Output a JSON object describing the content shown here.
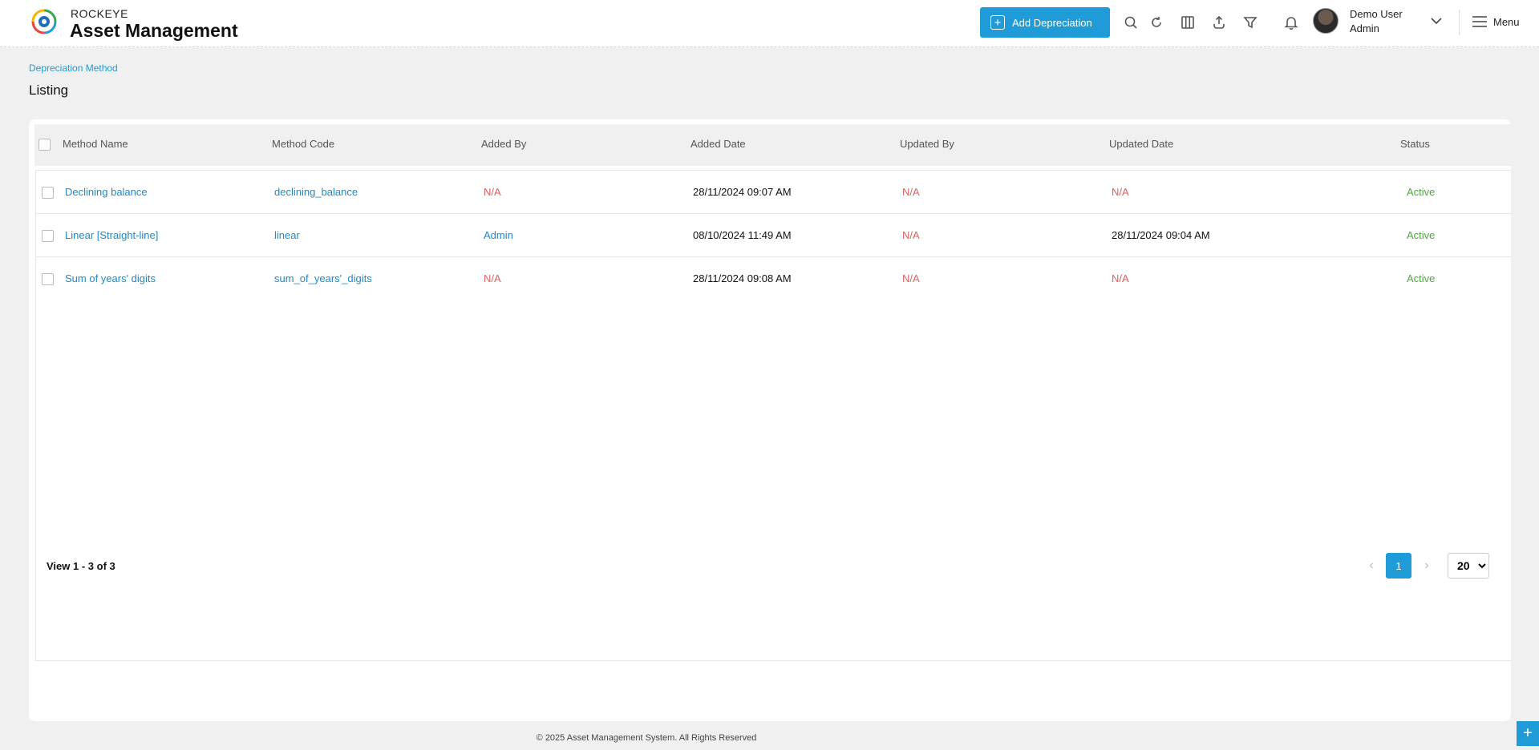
{
  "brand": {
    "top": "ROCKEYE",
    "name": "Asset Management"
  },
  "header": {
    "add_button": "Add Depreciation",
    "user_name": "Demo User",
    "user_role": "Admin",
    "menu_label": "Menu"
  },
  "breadcrumb": "Depreciation Method",
  "page_title": "Listing",
  "table": {
    "columns": [
      "Method Name",
      "Method Code",
      "Added By",
      "Added Date",
      "Updated By",
      "Updated Date",
      "Status"
    ],
    "rows": [
      {
        "name": "Declining balance",
        "code": "declining_balance",
        "added_by": "N/A",
        "added_date": "28/11/2024 09:07 AM",
        "updated_by": "N/A",
        "updated_date": "N/A",
        "status": "Active"
      },
      {
        "name": "Linear [Straight-line]",
        "code": "linear",
        "added_by": "Admin",
        "added_date": "08/10/2024 11:49 AM",
        "updated_by": "N/A",
        "updated_date": "28/11/2024 09:04 AM",
        "status": "Active"
      },
      {
        "name": "Sum of years' digits",
        "code": "sum_of_years'_digits",
        "added_by": "N/A",
        "added_date": "28/11/2024 09:08 AM",
        "updated_by": "N/A",
        "updated_date": "N/A",
        "status": "Active"
      }
    ]
  },
  "pagination": {
    "summary": "View 1 - 3 of 3",
    "current_page": "1",
    "page_size": "20",
    "prev": "‹",
    "next": "›"
  },
  "footer": {
    "copyright": "© 2025 Asset Management System. All Rights Reserved",
    "fab": "+"
  },
  "colors": {
    "accent": "#1f9bd7",
    "link": "#1f89c8",
    "na": "#e06060",
    "active": "#4caa3c"
  },
  "icons": [
    "search-icon",
    "refresh-icon",
    "columns-icon",
    "export-icon",
    "filter-icon",
    "bell-icon",
    "chevron-down-icon",
    "hamburger-icon"
  ]
}
